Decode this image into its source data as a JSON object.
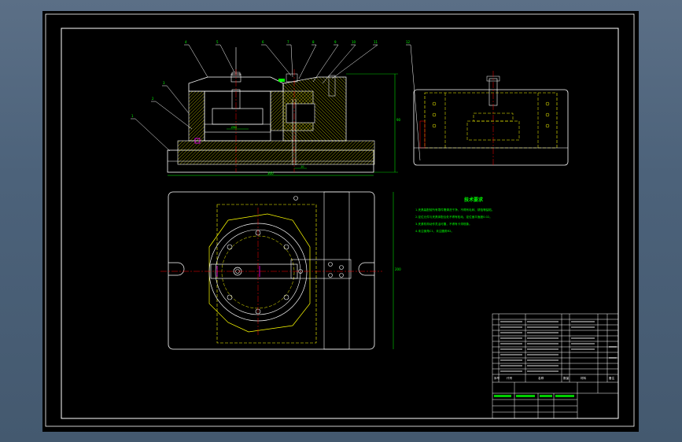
{
  "colors": {
    "background": "#000000",
    "outline": "#ffffff",
    "hatch": "#ffff00",
    "hidden": "#ffff00",
    "center": "#ff0000",
    "dimension": "#00ff00",
    "highlight": "#ff00ff"
  },
  "callouts": [
    "4",
    "5",
    "6",
    "7",
    "8",
    "9",
    "10",
    "11",
    "3",
    "2",
    "1",
    "12"
  ],
  "dimensions": {
    "overall_width": "300",
    "overall_height": "90",
    "plan_height": "200",
    "center_dim": "Ø60",
    "slot_dim": "10"
  },
  "technical_notes": {
    "title": "技术要求",
    "lines": [
      "1.夹具装配前所有零件需清洗干净，不得有毛刺、锈蚀等缺陷。",
      "2.定位元件与夹具体配合处不得有松动，定位面平面度0.02。",
      "3.夹紧机构动作灵活可靠，不得有卡滞现象。",
      "4.未注倒角C1，未注圆角R2。"
    ]
  },
  "title_block": {
    "col_seq": "序号",
    "col_code": "代号",
    "col_name": "名称",
    "col_qty": "数量",
    "col_material": "材料",
    "col_note": "备注"
  }
}
